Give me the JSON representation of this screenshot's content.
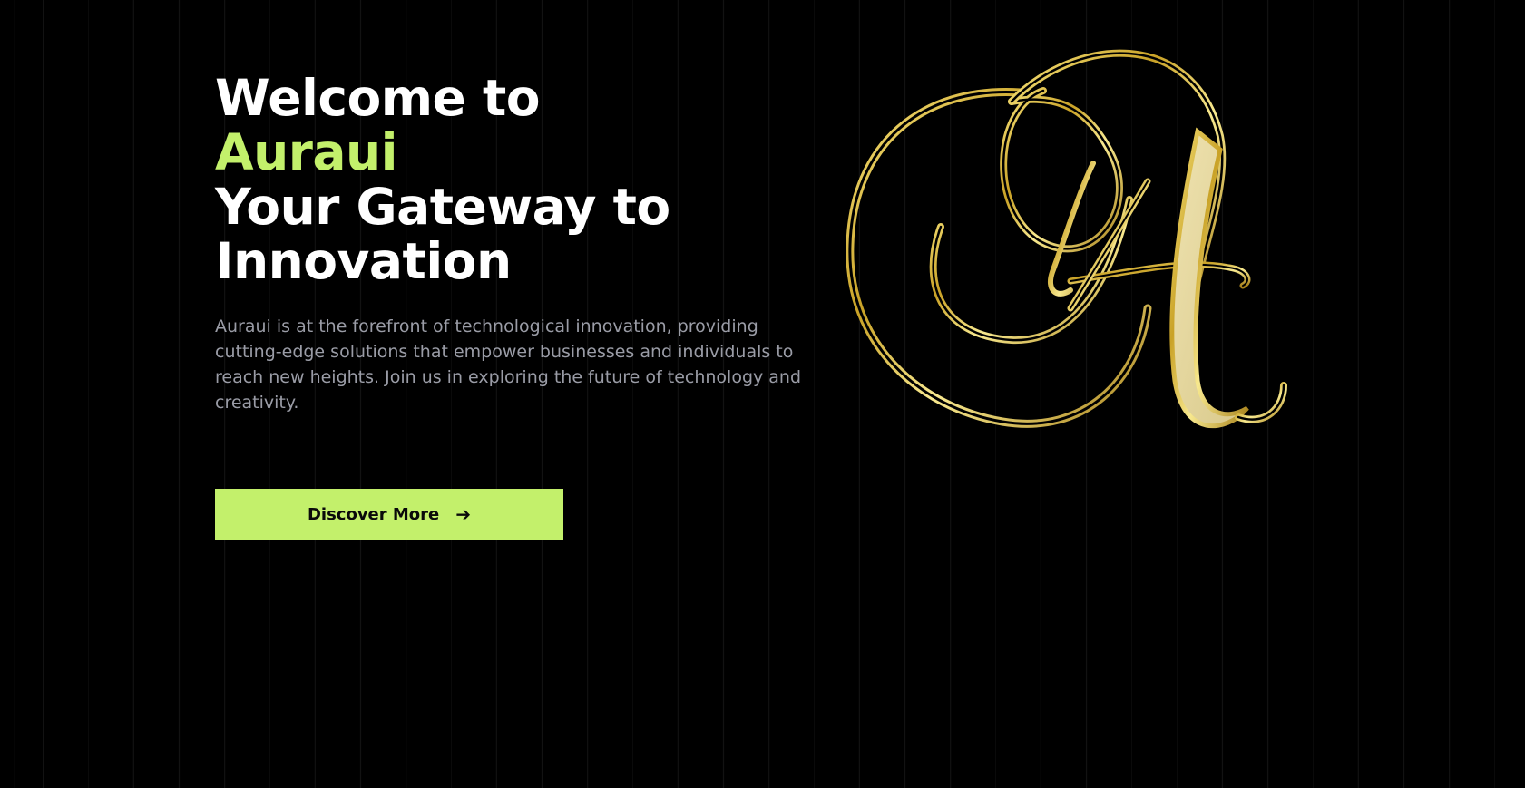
{
  "hero": {
    "title_line1": "Welcome to",
    "title_brand": "Auraui",
    "title_line3": "Your Gateway to",
    "title_line4": "Innovation",
    "description": "Auraui is at the forefront of technological innovation, providing cutting-edge solutions that empower businesses and individuals to reach new heights. Join us in exploring the future of technology and creativity."
  },
  "cta": {
    "label": "Discover More",
    "arrow": "➔",
    "icon": "arrow-right-icon"
  },
  "logo": {
    "icon": "gold-monogram-a-icon"
  },
  "colors": {
    "background": "#000000",
    "accent": "#c3f06b",
    "heading": "#ffffff",
    "body_text": "#9a9ca6",
    "gold": "#d9b949"
  }
}
